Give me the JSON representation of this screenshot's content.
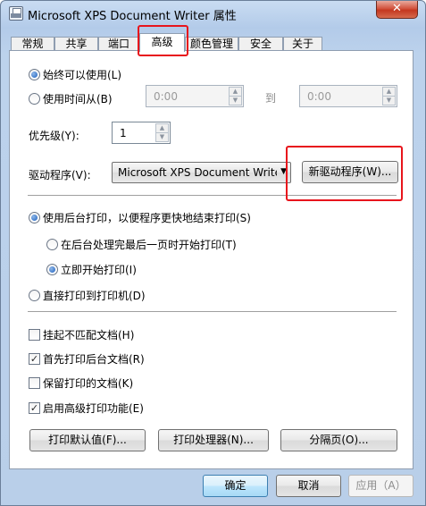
{
  "window": {
    "title": "Microsoft XPS Document Writer 属性",
    "close_glyph": "✕"
  },
  "tabs": [
    {
      "label": "常规",
      "active": false
    },
    {
      "label": "共享",
      "active": false
    },
    {
      "label": "端口",
      "active": false
    },
    {
      "label": "高级",
      "active": true
    },
    {
      "label": "颜色管理",
      "active": false
    },
    {
      "label": "安全",
      "active": false
    },
    {
      "label": "关于",
      "active": false
    }
  ],
  "availability": {
    "always_label": "始终可以使用(L)",
    "always_checked": true,
    "from_label": "使用时间从(B)",
    "from_checked": false,
    "from_time": "0:00",
    "to_label": "到",
    "to_time": "0:00"
  },
  "priority": {
    "label": "优先级(Y):",
    "value": "1"
  },
  "driver": {
    "label": "驱动程序(V):",
    "selected": "Microsoft XPS Document Writer",
    "new_driver_button": "新驱动程序(W)..."
  },
  "spooling": {
    "spool_label": "使用后台打印，以便程序更快地结束打印(S)",
    "spool_checked": true,
    "after_last_page_label": "在后台处理完最后一页时开始打印(T)",
    "after_last_page_checked": false,
    "immediately_label": "立即开始打印(I)",
    "immediately_checked": true,
    "direct_label": "直接打印到打印机(D)",
    "direct_checked": false
  },
  "options": [
    {
      "label": "挂起不匹配文档(H)",
      "checked": false
    },
    {
      "label": "首先打印后台文档(R)",
      "checked": true
    },
    {
      "label": "保留打印的文档(K)",
      "checked": false
    },
    {
      "label": "启用高级打印功能(E)",
      "checked": true
    }
  ],
  "bottom_buttons": {
    "defaults": "打印默认值(F)...",
    "processor": "打印处理器(N)...",
    "separator_page": "分隔页(O)..."
  },
  "dialog_buttons": {
    "ok": "确定",
    "cancel": "取消",
    "apply": "应用（A）"
  },
  "spin_glyphs": {
    "up": "▲",
    "down": "▼"
  },
  "select_arrow_glyph": "▼",
  "check_glyph": "✓",
  "highlight_color": "#e8151c"
}
